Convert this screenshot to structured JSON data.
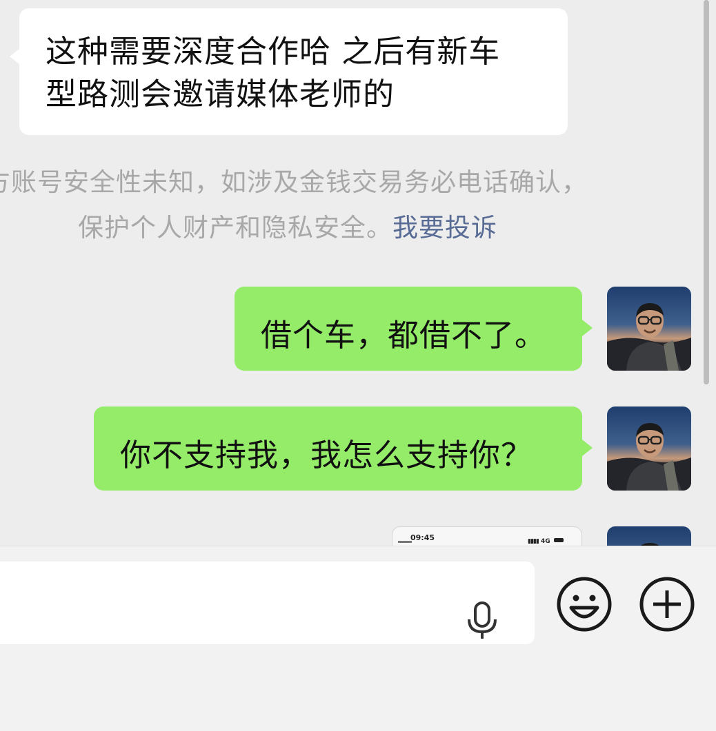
{
  "messages": {
    "incoming": {
      "line1": "这种需要深度合作哈 之后有新车",
      "line2": "型路测会邀请媒体老师的"
    },
    "notice": {
      "line1": "方账号安全性未知，如涉及金钱交易务必电话确认，",
      "line2": "保护个人财产和隐私安全。",
      "link": "我要投诉"
    },
    "outgoing_1": "借个车，都借不了。",
    "outgoing_2": "你不支持我，我怎么支持你？",
    "thumbnail": {
      "time": "09:45",
      "network": "4G"
    }
  },
  "input_bar": {
    "icons": [
      "microphone-icon",
      "emoji-icon",
      "plus-icon"
    ]
  },
  "colors": {
    "chat_background": "#ededed",
    "incoming_bubble": "#ffffff",
    "outgoing_bubble": "#95ec69",
    "link": "#576b95",
    "notice_text": "#a8a8a8"
  }
}
